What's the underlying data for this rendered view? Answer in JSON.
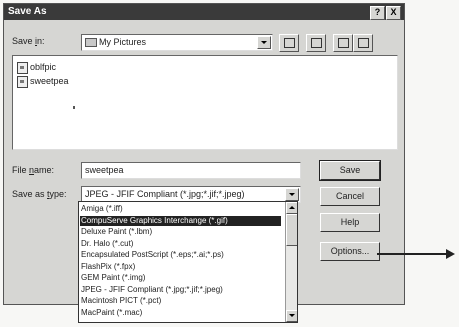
{
  "window": {
    "title": "Save As",
    "help_glyph": "?",
    "close_glyph": "X"
  },
  "save_in": {
    "label_pre": "Save ",
    "label_key": "i",
    "label_post": "n:",
    "value": "My Pictures"
  },
  "toolbar_icons": [
    "up-folder-icon",
    "new-folder-icon",
    "list-view-icon",
    "details-view-icon"
  ],
  "files": [
    {
      "name": "oblfpic",
      "icon": "image-file-icon"
    },
    {
      "name": "sweetpea",
      "icon": "image-file-icon"
    }
  ],
  "file_name": {
    "label_pre": "File ",
    "label_key": "n",
    "label_post": "ame:",
    "value": "sweetpea"
  },
  "save_as_type": {
    "label_pre": "Save as ",
    "label_key": "t",
    "label_post": "ype:",
    "value": "JPEG - JFIF Compliant (*.jpg;*.jif;*.jpeg)"
  },
  "buttons": {
    "save": "Save",
    "cancel": "Cancel",
    "help": "Help",
    "options": "Options..."
  },
  "type_options": [
    "Amiga (*.iff)",
    "CompuServe Graphics Interchange (*.gif)",
    "Deluxe Paint (*.lbm)",
    "Dr. Halo (*.cut)",
    "Encapsulated PostScript (*.eps;*.ai;*.ps)",
    "FlashPix (*.fpx)",
    "GEM Paint (*.img)",
    "JPEG - JFIF Compliant (*.jpg;*.jif;*.jpeg)",
    "Macintosh PICT (*.pct)",
    "MacPaint (*.mac)"
  ],
  "selected_type_index": 1
}
